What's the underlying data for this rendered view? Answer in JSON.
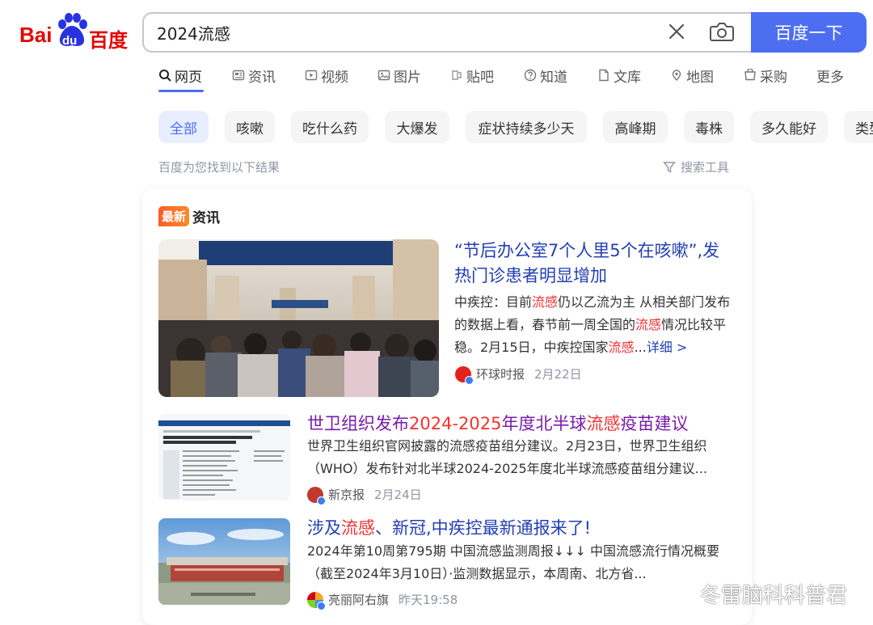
{
  "header": {
    "logo_text_a": "Bai",
    "logo_text_b": "百度",
    "logo_paw": "du",
    "search_value": "2024流感",
    "search_button": "百度一下"
  },
  "tabs": [
    {
      "label": "网页",
      "icon": "search-icon"
    },
    {
      "label": "资讯",
      "icon": "news-icon"
    },
    {
      "label": "视频",
      "icon": "video-icon"
    },
    {
      "label": "图片",
      "icon": "image-icon"
    },
    {
      "label": "贴吧",
      "icon": "tieba-icon"
    },
    {
      "label": "知道",
      "icon": "question-icon"
    },
    {
      "label": "文库",
      "icon": "document-icon"
    },
    {
      "label": "地图",
      "icon": "map-icon"
    },
    {
      "label": "采购",
      "icon": "cart-icon"
    },
    {
      "label": "更多",
      "icon": ""
    }
  ],
  "chips": [
    "全部",
    "咳嗽",
    "吃什么药",
    "大爆发",
    "症状持续多少天",
    "高峰期",
    "毒株",
    "多久能好",
    "类型"
  ],
  "result_hint": "百度为您找到以下结果",
  "tools_label": "搜索工具",
  "news": {
    "badge_new": "最新",
    "badge_label": "资讯",
    "items": [
      {
        "title_line1": "“节后办公室7个人里5个在咳嗽”,发",
        "title_line2": "热门诊患者明显增加",
        "snippet": [
          "中疾控：目前",
          "流感",
          "仍以乙流为主 从相关部门发",
          "布的数据上看，春节前一周全国的",
          "流感",
          "情况比",
          "较平稳。2月15日，中疾控国家",
          "流感",
          "...",
          "详细 >"
        ],
        "source": "环球时报",
        "date": "2月22日"
      },
      {
        "title": [
          "世卫组织发布",
          "2024-2025",
          "年度北半球",
          "流感",
          "疫苗建议"
        ],
        "snippet_line1": "世界卫生组织官网披露的流感疫苗组分建议。2月23日，世界卫生组织",
        "snippet_line2": "（WHO）发布针对北半球2024-2025年度北半球流感疫苗组分建议...",
        "source": "新京报",
        "date": "2月24日"
      },
      {
        "title": [
          "涉及",
          "流感",
          "、新冠,中疾控最新通报来了!"
        ],
        "snippet_line1": "2024年第10周第795期 中国流感监测周报↓↓↓ 中国流感流行情况概要",
        "snippet_line2": "（截至2024年3月10日）·监测数据显示，本周南、北方省...",
        "source": "亮丽阿右旗",
        "date": "昨天19:58"
      }
    ]
  },
  "watermark": "冬雷脑科科普君",
  "colors": {
    "accent": "#4e6ef2",
    "highlight": "#f73131",
    "link": "#2440b3",
    "visited": "#771caa"
  }
}
